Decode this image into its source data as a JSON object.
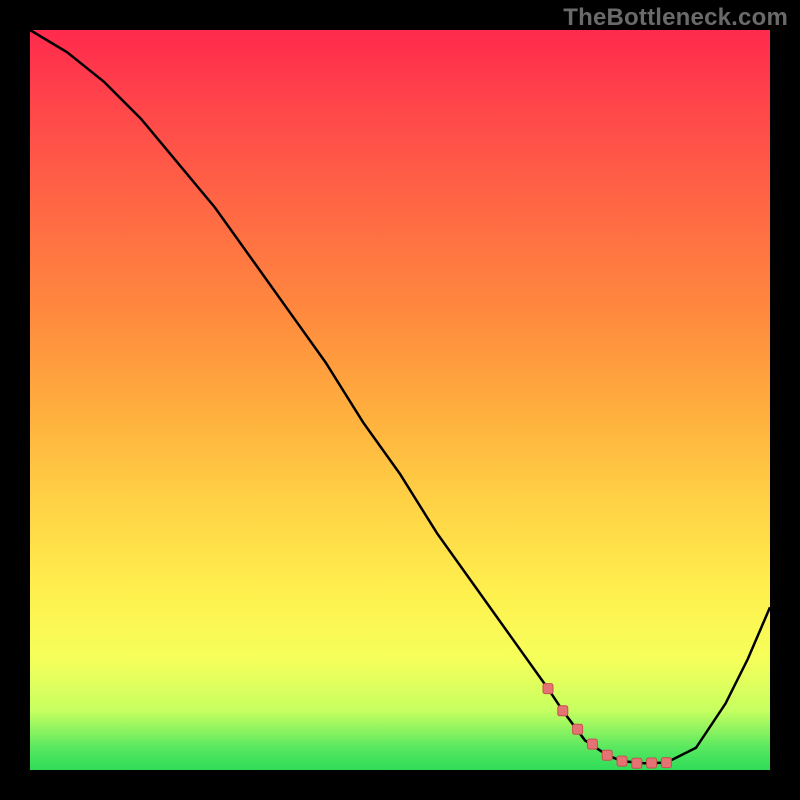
{
  "watermark": "TheBottleneck.com",
  "colors": {
    "background": "#000000",
    "curve": "#000000",
    "marker_fill": "#e57373",
    "marker_stroke": "#c84f4f"
  },
  "chart_data": {
    "type": "line",
    "title": "",
    "xlabel": "",
    "ylabel": "",
    "xlim": [
      0,
      100
    ],
    "ylim": [
      0,
      100
    ],
    "grid": false,
    "legend": false,
    "series": [
      {
        "name": "bottleneck-curve",
        "x": [
          0,
          5,
          10,
          15,
          20,
          25,
          30,
          35,
          40,
          45,
          50,
          55,
          60,
          65,
          70,
          72,
          75,
          78,
          80,
          83,
          86,
          90,
          94,
          97,
          100
        ],
        "values": [
          100,
          97,
          93,
          88,
          82,
          76,
          69,
          62,
          55,
          47,
          40,
          32,
          25,
          18,
          11,
          8,
          4,
          2,
          1.2,
          0.9,
          1.0,
          3,
          9,
          15,
          22
        ]
      }
    ],
    "highlight_points": {
      "name": "optimal-range",
      "x": [
        70,
        72,
        74,
        76,
        78,
        80,
        82,
        84,
        86
      ],
      "values": [
        11,
        8,
        5.5,
        3.5,
        2.0,
        1.2,
        0.9,
        0.95,
        1.0
      ]
    }
  }
}
